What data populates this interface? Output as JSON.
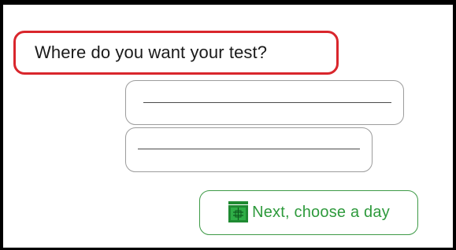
{
  "question": {
    "text": "Where do you want your test?"
  },
  "answers": [
    {
      "value": ""
    },
    {
      "value": ""
    }
  ],
  "next_button": {
    "label": "Next, choose a day",
    "icon": "calendar-icon"
  },
  "colors": {
    "question_border": "#d9262c",
    "answer_border": "#9c9c9c",
    "next_border": "#3d9a46",
    "next_text": "#2e9a3c",
    "next_icon": "#1f8a32"
  }
}
